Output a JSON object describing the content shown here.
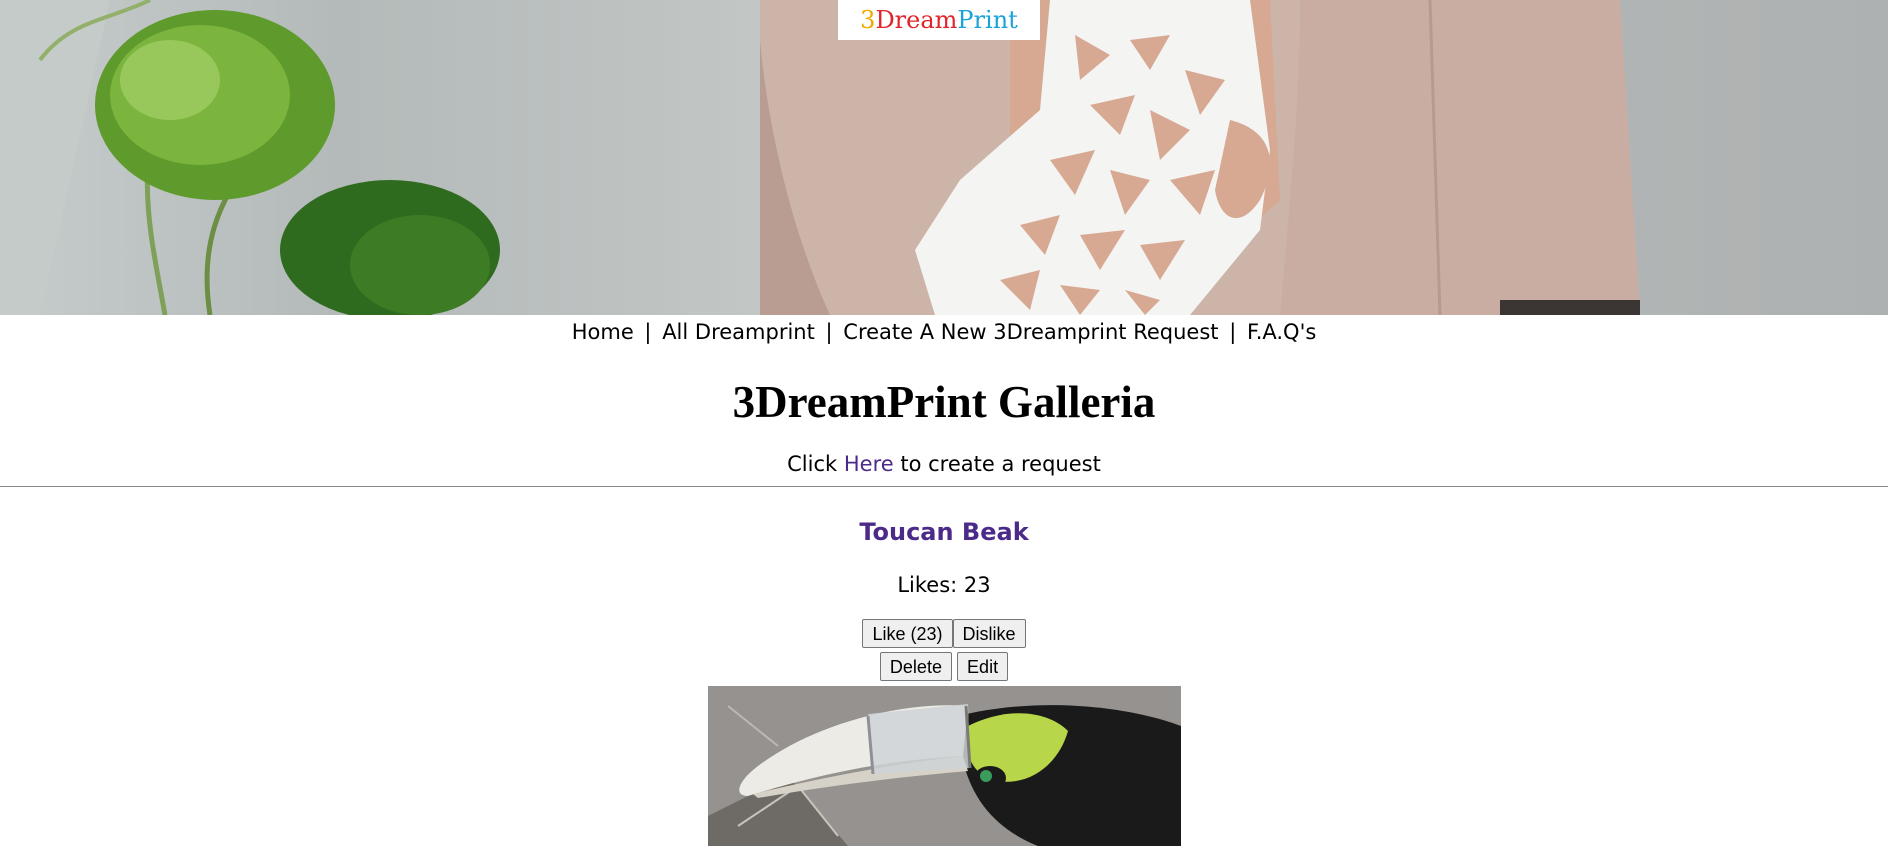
{
  "logo": {
    "part1": "3",
    "part2": "Dream",
    "part3": "Print"
  },
  "nav": {
    "home": "Home",
    "all": "All Dreamprint",
    "create": "Create A New 3Dreamprint Request",
    "faq": "F.A.Q's",
    "separator": "|"
  },
  "page": {
    "title": "3DreamPrint Galleria",
    "cta_before": "Click",
    "cta_link": "Here",
    "cta_after": "to create a request"
  },
  "item": {
    "title": "Toucan Beak",
    "likes_text": "Likes: 23",
    "like_button": "Like (23)",
    "dislike_button": "Dislike",
    "delete_button": "Delete",
    "edit_button": "Edit"
  },
  "colors": {
    "link": "#4b2a8a",
    "logo_3": "#f2a900",
    "logo_dream": "#e0242b",
    "logo_print": "#1ba2d8"
  }
}
